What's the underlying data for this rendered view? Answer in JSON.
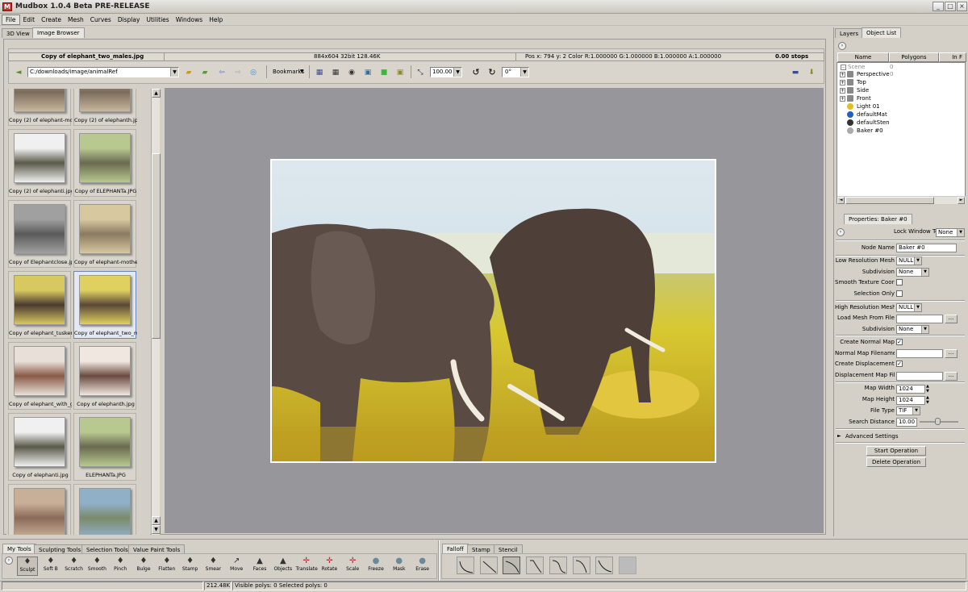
{
  "window": {
    "title": "Mudbox 1.0.4 Beta PRE-RELEASE",
    "app_icon": "M",
    "minimize": "_",
    "maximize": "□",
    "close": "×"
  },
  "menu": [
    "File",
    "Edit",
    "Create",
    "Mesh",
    "Curves",
    "Display",
    "Utilities",
    "Windows",
    "Help"
  ],
  "view_tabs": [
    "3D View",
    "Image Browser"
  ],
  "right_tabs": [
    "Layers",
    "Object List"
  ],
  "info": {
    "filename": "Copy of elephant_two_males.jpg",
    "dims": "884x604  32bit  128.46K",
    "pos": "Pos x: 794 y: 2 Color R:1.000000 G:1.000000 B:1.000000 A:1.000000",
    "stops": "0.00 stops"
  },
  "toolbar": {
    "path": "C:/downloads/image/animalRef",
    "bookmarks": "Bookmarks",
    "zoom": "100.00",
    "rotation": "0°"
  },
  "thumbnails": [
    {
      "label": "Copy (2) of elephant-mot",
      "kind": "photo-land"
    },
    {
      "label": "Copy (2) of elephanth.jpg",
      "kind": "photo-land"
    },
    {
      "label": "Copy (2) of elephanti.jpg",
      "kind": "portrait"
    },
    {
      "label": "Copy of ELEPHANTa.JPG",
      "kind": "green"
    },
    {
      "label": "Copy of Elephantclose.jpg",
      "kind": "gray"
    },
    {
      "label": "Copy of elephant-mother",
      "kind": "herd"
    },
    {
      "label": "Copy of elephant_tusker.",
      "kind": "yellow"
    },
    {
      "label": "Copy of elephant_two_m",
      "kind": "yellow2"
    },
    {
      "label": "Copy of elephant_with_g",
      "kind": "brown"
    },
    {
      "label": "Copy of elephanth.jpg",
      "kind": "brown2"
    },
    {
      "label": "Copy of elephanti.jpg",
      "kind": "portrait"
    },
    {
      "label": "ELEPHANTa.JPG",
      "kind": "green"
    },
    {
      "label": "",
      "kind": "herd2"
    },
    {
      "label": "",
      "kind": "water"
    }
  ],
  "object_list": {
    "columns": [
      "Name",
      "Polygons",
      "In F"
    ],
    "scene_label": "Scene",
    "scene_count": "0",
    "items": [
      {
        "name": "Perspective",
        "count": "0",
        "icon": "camera",
        "expandable": true
      },
      {
        "name": "Top",
        "count": "",
        "icon": "camera",
        "expandable": true
      },
      {
        "name": "Side",
        "count": "",
        "icon": "camera",
        "expandable": true
      },
      {
        "name": "Front",
        "count": "",
        "icon": "camera",
        "expandable": true
      },
      {
        "name": "Light 01",
        "count": "",
        "icon": "light",
        "expandable": false
      },
      {
        "name": "defaultMat",
        "count": "",
        "icon": "material",
        "expandable": false
      },
      {
        "name": "defaultSten",
        "count": "",
        "icon": "stencil",
        "expandable": false
      },
      {
        "name": "Baker #0",
        "count": "",
        "icon": "baker",
        "expandable": false
      }
    ]
  },
  "properties": {
    "tab": "Properties: Baker #0",
    "lock_window_label": "Lock Window To:",
    "lock_window_value": "None",
    "node_name_label": "Node Name",
    "node_name": "Baker #0",
    "low_res_mesh_label": "Low Resolution Mesh",
    "low_res_mesh": "NULL",
    "subdivision_label": "Subdivision",
    "subdivision": "None",
    "smooth_tex_label": "Smooth Texture Coors",
    "selection_only_label": "Selection Only",
    "high_res_mesh_label": "High Resolution Mesh",
    "high_res_mesh": "NULL",
    "load_mesh_label": "Load Mesh From File",
    "subdivision2_label": "Subdivision",
    "subdivision2": "None",
    "create_normal_label": "Create Normal Map",
    "normal_filename_label": "Normal Map Filename",
    "create_disp_label": "Create Displacement Map",
    "disp_filename_label": "Displacement Map Filename",
    "map_width_label": "Map Width",
    "map_width": "1024",
    "map_height_label": "Map Height",
    "map_height": "1024",
    "file_type_label": "File Type",
    "file_type": "TIF",
    "search_distance_label": "Search Distance",
    "search_distance": "10.00",
    "advanced_label": "Advanced Settings",
    "start_label": "Start Operation",
    "delete_label": "Delete Operation",
    "ellipsis": "...",
    "check": "✓"
  },
  "tool_tabs": [
    "My Tools",
    "Sculpting Tools",
    "Selection Tools",
    "Value Paint Tools"
  ],
  "tools": [
    {
      "label": "Sculpt",
      "icon": "♦"
    },
    {
      "label": "Soft B",
      "icon": "♦"
    },
    {
      "label": "Scratch",
      "icon": "♦"
    },
    {
      "label": "Smooth",
      "icon": "♦"
    },
    {
      "label": "Pinch",
      "icon": "♦"
    },
    {
      "label": "Bulge",
      "icon": "♦"
    },
    {
      "label": "Flatten",
      "icon": "♦"
    },
    {
      "label": "Stamp",
      "icon": "♦"
    },
    {
      "label": "Smear",
      "icon": "♦"
    },
    {
      "label": "Move",
      "icon": "↗"
    },
    {
      "label": "Faces",
      "icon": "▲"
    },
    {
      "label": "Objects",
      "icon": "▲"
    },
    {
      "label": "Translate",
      "icon": "✛"
    },
    {
      "label": "Rotate",
      "icon": "✛"
    },
    {
      "label": "Scale",
      "icon": "✛"
    },
    {
      "label": "Freeze",
      "icon": "●"
    },
    {
      "label": "Mask",
      "icon": "●"
    },
    {
      "label": "Erase",
      "icon": "●"
    }
  ],
  "falloff_tabs": [
    "Falloff",
    "Stamp",
    "Stencil"
  ],
  "status": {
    "memory": "212.48K",
    "polys": "Visible polys: 0   Selected polys: 0"
  },
  "colors": {
    "accent": "#6b86b8",
    "viewer_bg": "#97969a",
    "panel": "#d4d0c8"
  }
}
